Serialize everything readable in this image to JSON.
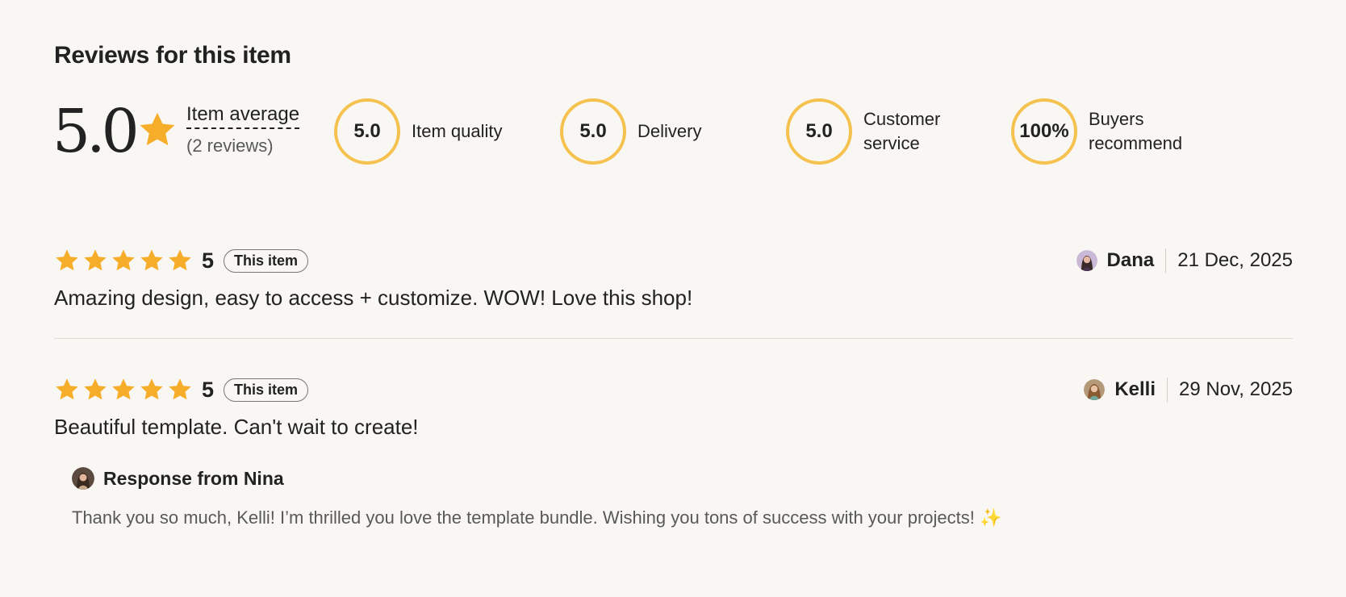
{
  "reviews_section": {
    "title": "Reviews for this item",
    "average": {
      "value": "5.0",
      "label": "Item average",
      "count": "(2 reviews)"
    },
    "metrics": [
      {
        "value": "5.0",
        "label": "Item quality"
      },
      {
        "value": "5.0",
        "label": "Delivery"
      },
      {
        "value": "5.0",
        "label": "Customer service"
      },
      {
        "value": "100%",
        "label": "Buyers recommend"
      }
    ],
    "reviews": [
      {
        "stars": 5,
        "rating": "5",
        "badge": "This item",
        "author": "Dana",
        "date": "21 Dec, 2025",
        "text": "Amazing design, easy to access + customize. WOW! Love this shop!"
      },
      {
        "stars": 5,
        "rating": "5",
        "badge": "This item",
        "author": "Kelli",
        "date": "29 Nov, 2025",
        "text": "Beautiful template. Can't wait to create!",
        "response": {
          "title": "Response from Nina",
          "text": "Thank you so much, Kelli! I’m thrilled you love the template bundle. Wishing you tons of success with your projects! ✨"
        }
      }
    ]
  },
  "colors": {
    "star": "#f6ad2a",
    "ring": "#f6c24f",
    "background": "#f9f7f3"
  },
  "icons": {
    "star": "star-icon",
    "avatar": "avatar-icon"
  }
}
